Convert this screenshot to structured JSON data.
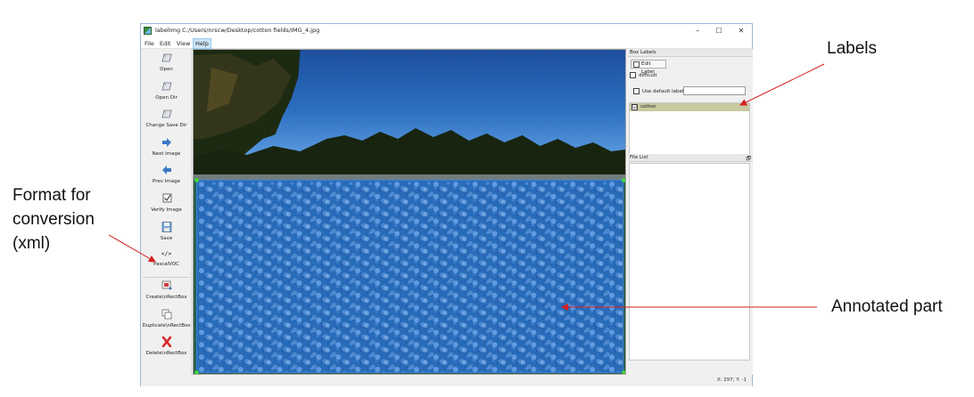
{
  "window": {
    "title": "labelImg C:/Users/nrscw/Desktop/cotton fields/IMG_4.jpg",
    "controls": [
      "–",
      "☐",
      "✕"
    ]
  },
  "menubar": {
    "items": [
      "File",
      "Edit",
      "View",
      "Help"
    ],
    "active": "Help"
  },
  "toolbar": {
    "open": "Open",
    "open_dir": "Open Dir",
    "change_save_dir": "Change Save Dir",
    "next_image": "Next Image",
    "prev_image": "Prev Image",
    "verify_image": "Verify Image",
    "save": "Save",
    "format_icon": "</>",
    "format": "PascalVOC",
    "create_rect": "Create\\nRectBox",
    "duplicate_rect": "Duplicate\\nRectBox",
    "delete_rect": "Delete\\nRectBox",
    "more": "»"
  },
  "box_labels": {
    "title": "Box Labels",
    "edit_label": "Edit Label",
    "difficult": "difficult",
    "use_default_label": "Use default label",
    "default_label_value": "",
    "labels": [
      "cotton"
    ],
    "label_checked": "☑"
  },
  "file_list": {
    "title": "File List",
    "float_icon": "🗗"
  },
  "status": {
    "coords": "X: 297; Y: -1"
  },
  "callouts": {
    "labels": "Labels",
    "format_line1": "Format for",
    "format_line2": "conversion",
    "format_line3": "(xml)",
    "annotated_part": "Annotated part"
  },
  "colors": {
    "annotation_fill": "#286ed7",
    "handle": "#3ed13e",
    "arrow": "#d42020",
    "selected_label_bg": "#c8c9a0"
  }
}
